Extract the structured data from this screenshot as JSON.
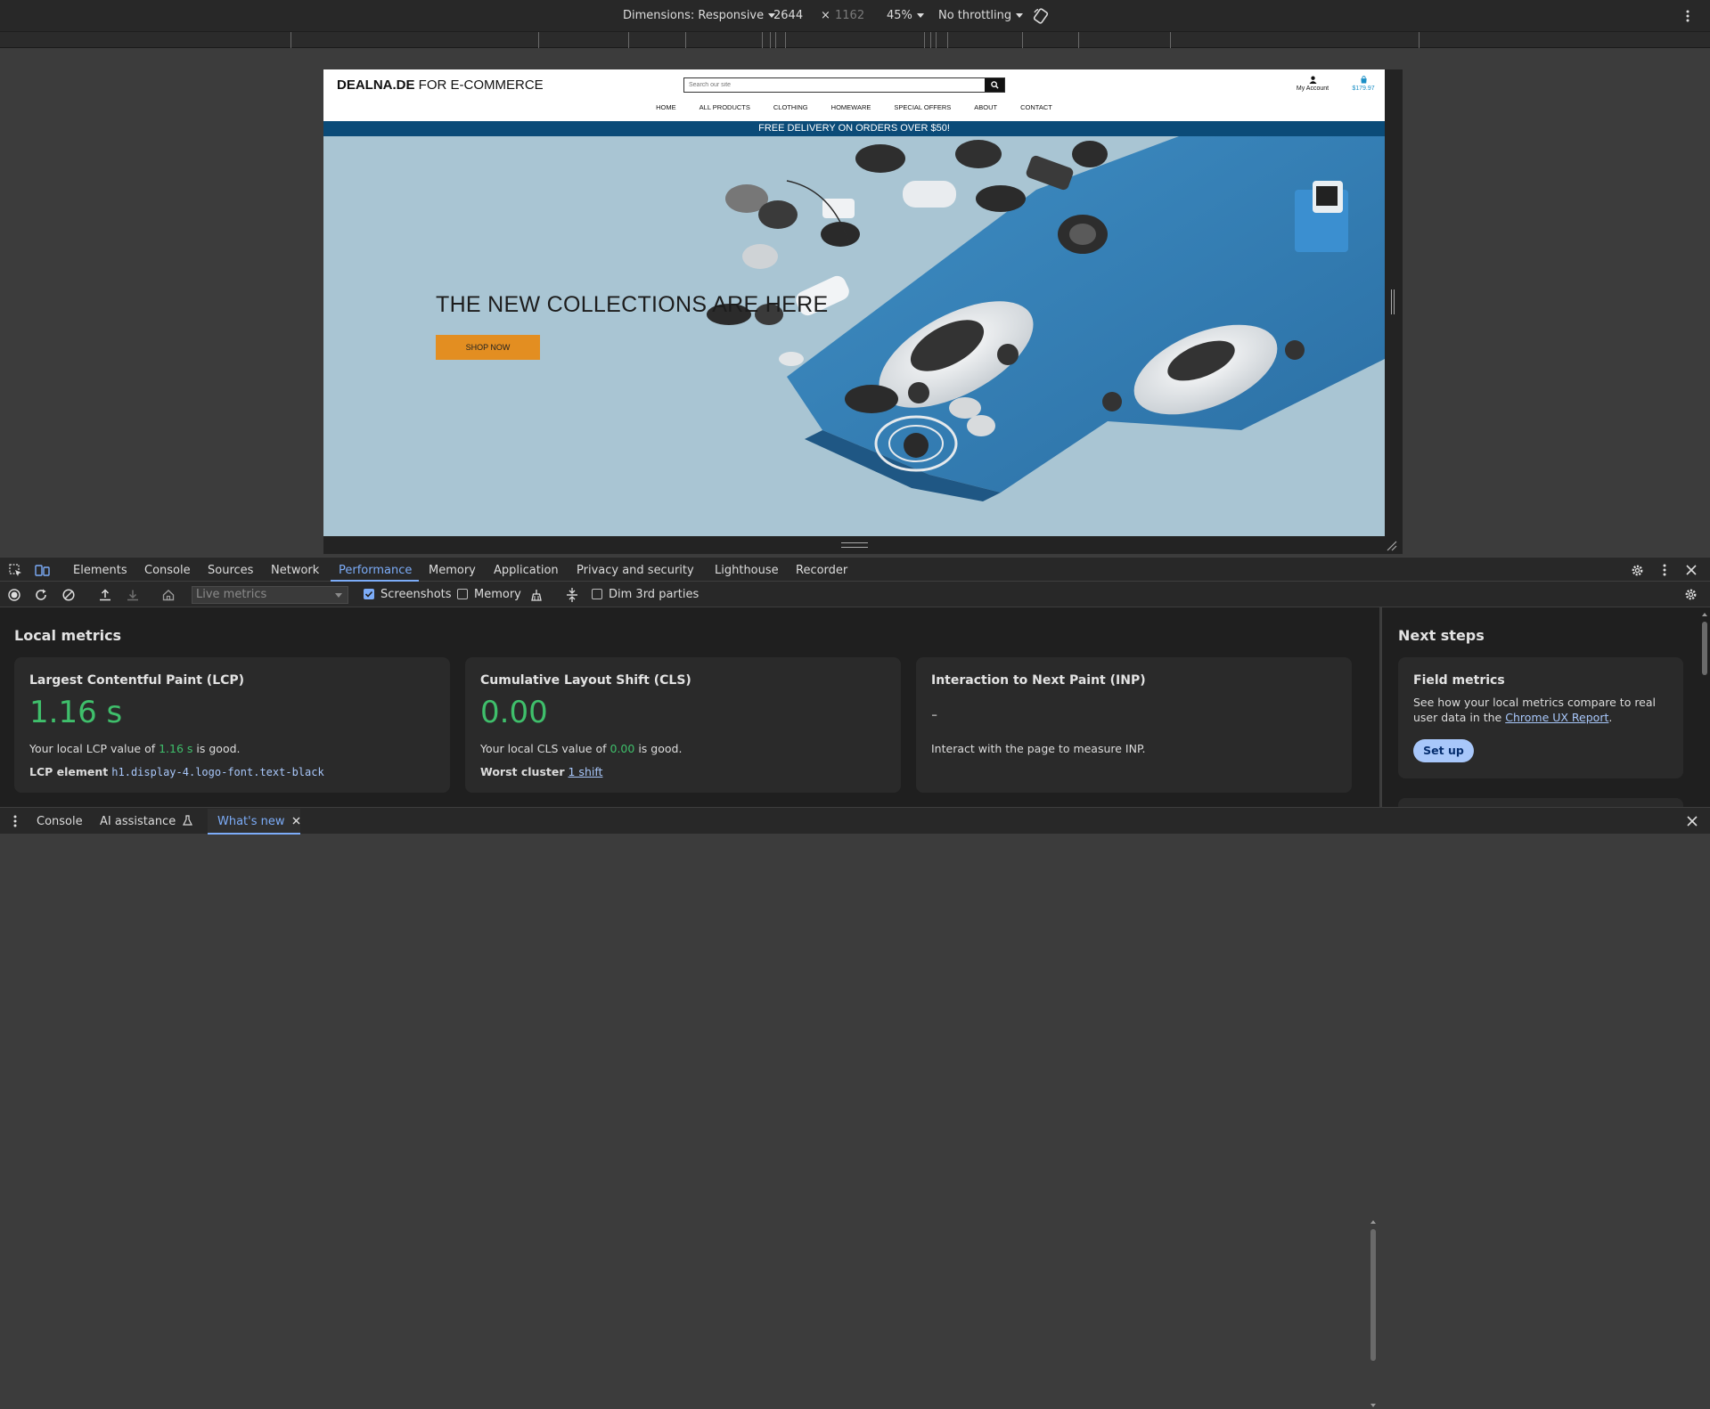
{
  "device_toolbar": {
    "dimensions_label": "Dimensions: Responsive",
    "width": "2644",
    "times": "×",
    "height": "1162",
    "zoom": "45%",
    "throttling": "No throttling"
  },
  "site": {
    "logo_bold": "DEALNA.DE",
    "logo_rest": " FOR E-COMMERCE",
    "search_placeholder": "Search our site",
    "account_label": "My Account",
    "cart_total": "$179.97",
    "nav": [
      "HOME",
      "ALL PRODUCTS",
      "CLOTHING",
      "HOMEWARE",
      "SPECIAL OFFERS",
      "ABOUT",
      "CONTACT"
    ],
    "promo": "FREE DELIVERY ON ORDERS OVER $50!",
    "hero_title": "THE NEW COLLECTIONS ARE HERE",
    "hero_button": "SHOP NOW"
  },
  "devtools": {
    "tabs": [
      "Elements",
      "Console",
      "Sources",
      "Network",
      "Performance",
      "Memory",
      "Application",
      "Privacy and security",
      "Lighthouse",
      "Recorder"
    ],
    "active_tab": "Performance",
    "perf_toolbar": {
      "live_metrics_placeholder": "Live metrics",
      "screenshots_label": "Screenshots",
      "screenshots_checked": true,
      "memory_label": "Memory",
      "memory_checked": false,
      "dim_label": "Dim 3rd parties",
      "dim_checked": false
    },
    "local_metrics": {
      "title": "Local metrics",
      "lcp": {
        "title": "Largest Contentful Paint (LCP)",
        "value": "1.16 s",
        "desc_prefix": "Your local LCP value of ",
        "desc_value": "1.16 s",
        "desc_suffix": " is good.",
        "element_label": "LCP element",
        "element_value": "h1.display-4.logo-font.text-black"
      },
      "cls": {
        "title": "Cumulative Layout Shift (CLS)",
        "value": "0.00",
        "desc_prefix": "Your local CLS value of ",
        "desc_value": "0.00",
        "desc_suffix": " is good.",
        "worst_label": "Worst cluster",
        "worst_value": "1 shift"
      },
      "inp": {
        "title": "Interaction to Next Paint (INP)",
        "value": "-",
        "desc": "Interact with the page to measure INP."
      }
    },
    "next_steps": {
      "title": "Next steps",
      "field_title": "Field metrics",
      "field_desc_prefix": "See how your local metrics compare to real user data in the ",
      "field_link": "Chrome UX Report",
      "field_desc_suffix": ".",
      "setup_button": "Set up"
    },
    "drawer": {
      "tabs": [
        "Console",
        "AI assistance",
        "What's new"
      ],
      "active": "What's new"
    }
  },
  "colors": {
    "good": "#3fbf6b",
    "accent": "#7cacf8",
    "promo_bar": "#0b4b78",
    "hero_button": "#e38e21"
  }
}
